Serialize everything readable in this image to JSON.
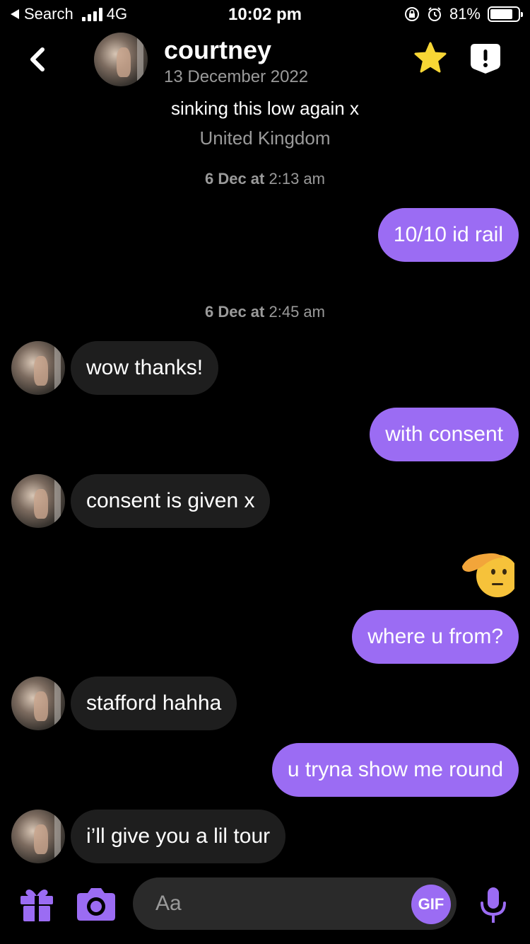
{
  "status_bar": {
    "back_app": "Search",
    "network": "4G",
    "time": "10:02 pm",
    "battery": "81%",
    "battery_level": 0.81
  },
  "header": {
    "name": "courtney",
    "date": "13 December 2022",
    "bio": "sinking this low again x",
    "location": "United Kingdom"
  },
  "timestamps": [
    {
      "day": "6 Dec at",
      "time": "2:13 am"
    },
    {
      "day": "6 Dec at",
      "time": "2:45 am"
    }
  ],
  "messages": [
    {
      "from": "me",
      "text": "10/10 id rail"
    },
    {
      "from": "them",
      "text": "wow thanks!"
    },
    {
      "from": "me",
      "text": "with consent"
    },
    {
      "from": "them",
      "text": "consent is given x"
    },
    {
      "from": "me",
      "text": "where u from?"
    },
    {
      "from": "them",
      "text": "stafford hahha"
    },
    {
      "from": "me",
      "text": "u tryna show me round"
    },
    {
      "from": "them",
      "text": "i’ll give you a lil tour"
    }
  ],
  "input": {
    "placeholder": "Aa",
    "gif_label": "GIF"
  },
  "colors": {
    "accent": "#9b6cf3",
    "incoming_bubble": "#1e1e1e",
    "star": "#f7d635"
  },
  "icons": [
    "back-chevron-icon",
    "star-icon",
    "report-icon",
    "gift-icon",
    "camera-icon",
    "microphone-icon",
    "saluting-face-emoji"
  ]
}
